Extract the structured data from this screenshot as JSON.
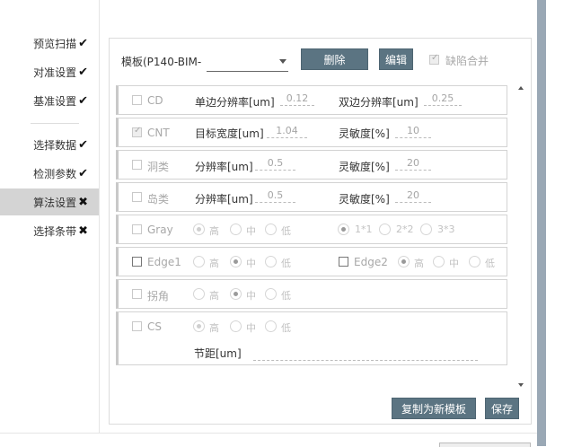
{
  "sidebar": {
    "items": [
      {
        "label": "预览扫描",
        "mark": "✔"
      },
      {
        "label": "对准设置",
        "mark": "✔"
      },
      {
        "label": "基准设置",
        "mark": "✔"
      },
      {
        "label": "选择数据",
        "mark": "✔"
      },
      {
        "label": "检测参数",
        "mark": "✔"
      },
      {
        "label": "算法设置",
        "mark": "✖"
      },
      {
        "label": "选择条带",
        "mark": "✖"
      }
    ]
  },
  "header": {
    "template_label": "模板(P140-BIM-",
    "delete_label": "删除",
    "edit_label": "编辑",
    "merge_label": "缺陷合并"
  },
  "rows": {
    "cd": {
      "label": "CD",
      "f1_label": "单边分辨率[um]",
      "f1_value": "0.12",
      "f2_label": "双边分辨率[um]",
      "f2_value": "0.25"
    },
    "cnt": {
      "label": "CNT",
      "f1_label": "目标宽度[um]",
      "f1_value": "1.04",
      "f2_label": "灵敏度[%]",
      "f2_value": "10"
    },
    "hole": {
      "label": "洞类",
      "f1_label": "分辨率[um]",
      "f1_value": "0.5",
      "f2_label": "灵敏度[%]",
      "f2_value": "20"
    },
    "island": {
      "label": "岛类",
      "f1_label": "分辨率[um]",
      "f1_value": "0.5",
      "f2_label": "灵敏度[%]",
      "f2_value": "20"
    },
    "gray": {
      "label": "Gray",
      "opt_high": "高",
      "opt_mid": "中",
      "opt_low": "低",
      "opt_1": "1*1",
      "opt_2": "2*2",
      "opt_3": "3*3"
    },
    "edge": {
      "label": "Edge1",
      "opt_high": "高",
      "opt_mid": "中",
      "opt_low": "低",
      "label2": "Edge2",
      "opt2_high": "高",
      "opt2_mid": "中",
      "opt2_low": "低"
    },
    "corner": {
      "label": "拐角",
      "opt_high": "高",
      "opt_mid": "中",
      "opt_low": "低"
    },
    "cs": {
      "label": "CS",
      "opt_high": "高",
      "opt_mid": "中",
      "opt_low": "低",
      "pitch_label": "节距[um]",
      "pitch_value": ""
    }
  },
  "footer": {
    "copy_label": "复制为新模板",
    "save_label": "保存"
  },
  "colors": {
    "button": "#5b7482",
    "active_nav": "#d4d4d4",
    "scroll_strip": "#9aa8b5"
  }
}
